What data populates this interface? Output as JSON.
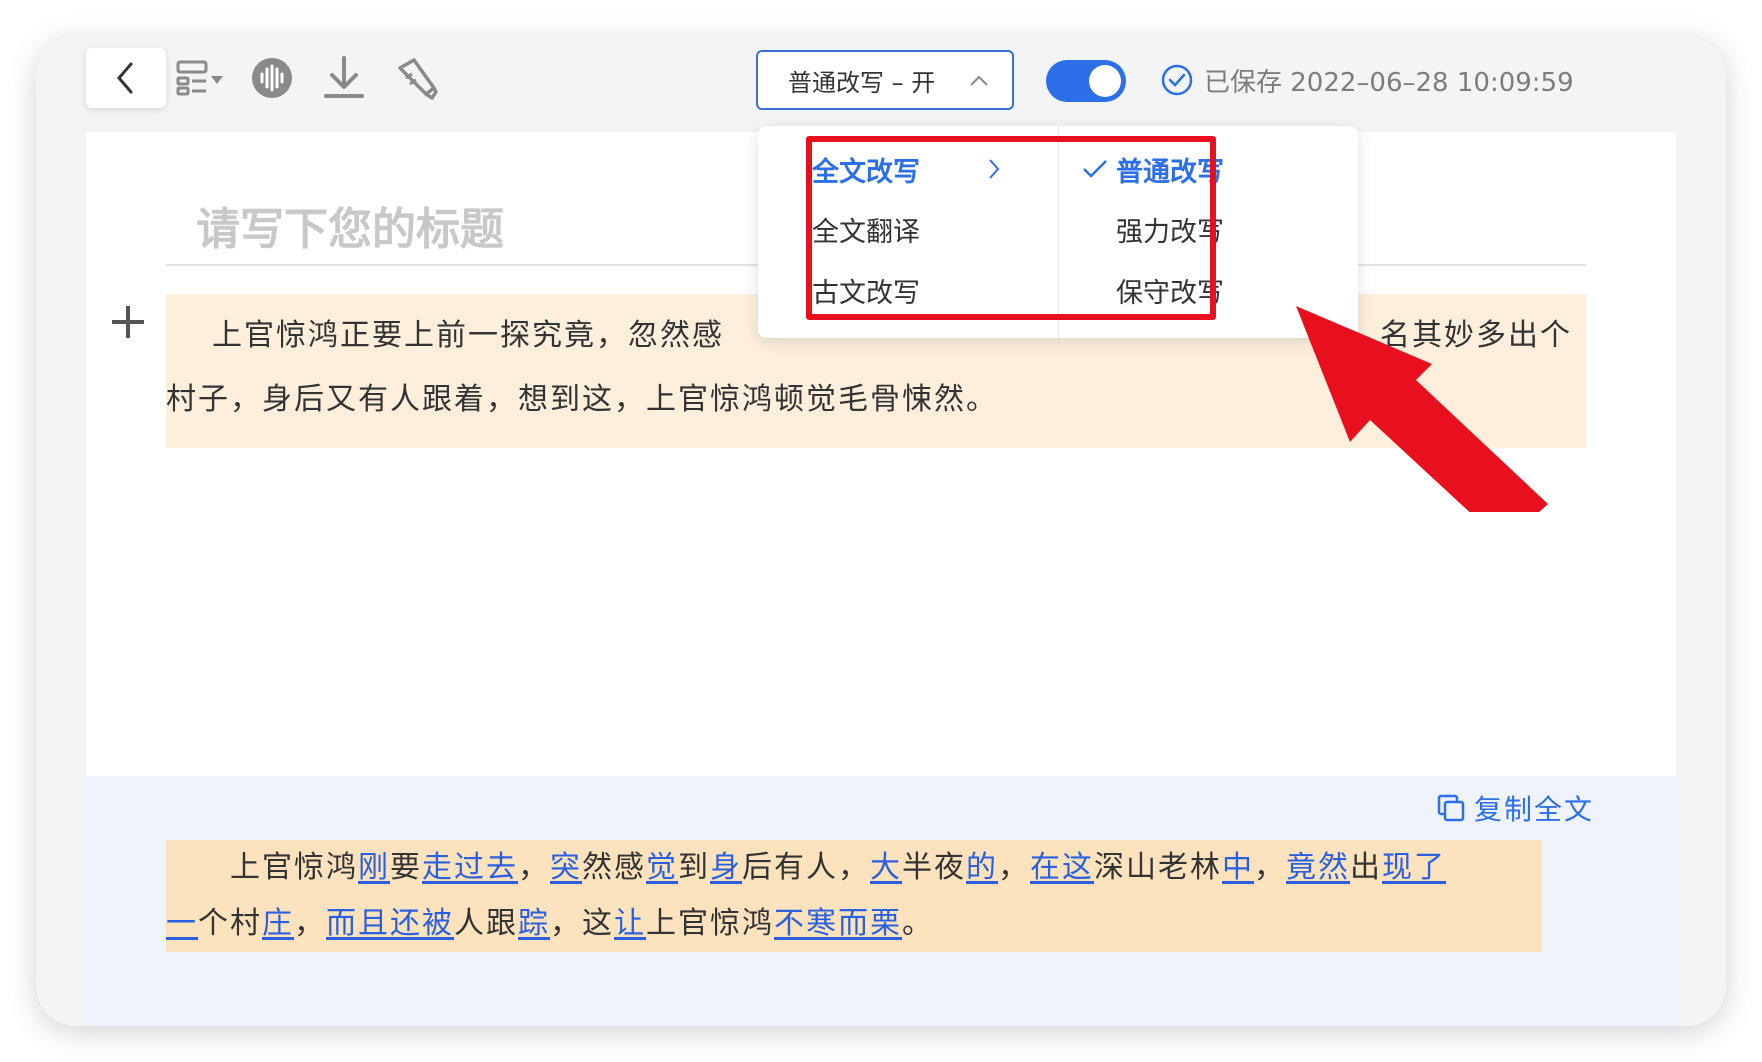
{
  "toolbar": {
    "back_icon": "chevron-left-icon",
    "layout_icon": "layout-dropdown-icon",
    "audio_icon": "audio-wave-icon",
    "download_icon": "download-icon",
    "brush_icon": "brush-icon",
    "mode_select": {
      "value": "普通改写 – 开"
    },
    "toggle": {
      "on": true,
      "color": "#2c6fe8"
    },
    "save_status": "已保存 2022–06–28 10:09:59"
  },
  "editor": {
    "title_placeholder": "请写下您的标题",
    "paragraph": {
      "line1": "上官惊鸿正要上前一探究竟，忽然感",
      "line1_tail": "名其妙多出个",
      "line2": "村子，身后又有人跟着，想到这，上官惊鸿顿觉毛骨悚然。",
      "background": "#fdefdc"
    }
  },
  "dropdown": {
    "left_items": [
      {
        "label": "全文改写",
        "active": true
      },
      {
        "label": "全文翻译",
        "active": false
      },
      {
        "label": "古文改写",
        "active": false
      }
    ],
    "right_items": [
      {
        "label": "普通改写",
        "checked": true
      },
      {
        "label": "强力改写",
        "checked": false
      },
      {
        "label": "保守改写",
        "checked": false
      }
    ],
    "highlight_color": "#e8101f"
  },
  "result": {
    "copy_label": "复制全文",
    "copy_icon": "copy-icon",
    "segments_line1": [
      {
        "t": "上官惊鸿",
        "h": false
      },
      {
        "t": "刚",
        "h": true
      },
      {
        "t": "要",
        "h": false
      },
      {
        "t": "走过去",
        "h": true
      },
      {
        "t": "，",
        "h": false
      },
      {
        "t": "突",
        "h": true
      },
      {
        "t": "然感",
        "h": false
      },
      {
        "t": "觉",
        "h": true
      },
      {
        "t": "到",
        "h": false
      },
      {
        "t": "身",
        "h": true
      },
      {
        "t": "后有人，",
        "h": false
      },
      {
        "t": "大",
        "h": true
      },
      {
        "t": "半夜",
        "h": false
      },
      {
        "t": "的",
        "h": true
      },
      {
        "t": "，",
        "h": false
      },
      {
        "t": "在这",
        "h": true
      },
      {
        "t": "深山老林",
        "h": false
      },
      {
        "t": "中",
        "h": true
      },
      {
        "t": "，",
        "h": false
      },
      {
        "t": "竟然",
        "h": true
      },
      {
        "t": "出",
        "h": false
      },
      {
        "t": "现了",
        "h": true
      }
    ],
    "segments_line2": [
      {
        "t": "一",
        "h": true
      },
      {
        "t": "个村",
        "h": false
      },
      {
        "t": "庄",
        "h": true
      },
      {
        "t": "，",
        "h": false
      },
      {
        "t": "而且还被",
        "h": true
      },
      {
        "t": "人跟",
        "h": false
      },
      {
        "t": "踪",
        "h": true
      },
      {
        "t": "，这",
        "h": false
      },
      {
        "t": "让",
        "h": true
      },
      {
        "t": "上官惊鸿",
        "h": false
      },
      {
        "t": "不寒而栗",
        "h": true
      },
      {
        "t": "。",
        "h": false
      }
    ],
    "highlight_color": "#2a5fe0"
  }
}
